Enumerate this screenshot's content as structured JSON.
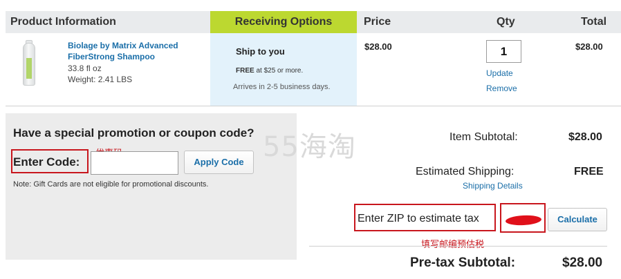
{
  "columns": {
    "product": "Product Information",
    "receiving": "Receiving Options",
    "price": "Price",
    "qty": "Qty",
    "total": "Total"
  },
  "product": {
    "name": "Biolage by Matrix Advanced FiberStrong Shampoo",
    "size": "33.8 fl oz",
    "weight": "Weight: 2.41 LBS",
    "price": "$28.00",
    "qty": "1",
    "total": "$28.00",
    "update_label": "Update",
    "remove_label": "Remove"
  },
  "shipping_option": {
    "title": "Ship to you",
    "free_bold": "FREE",
    "free_rest": " at $25 or more.",
    "days": "Arrives in 2-5 business days."
  },
  "promo": {
    "title": "Have a special promotion or coupon code?",
    "code_label": "Enter Code:",
    "code_value": "",
    "apply_label": "Apply Code",
    "note": "Note: Gift Cards are not eligible for promotional discounts."
  },
  "annotations": {
    "coupon": "优惠码",
    "zip": "填写邮编预估税"
  },
  "watermark": "55海淘",
  "summary": {
    "item_subtotal_label": "Item Subtotal:",
    "item_subtotal_value": "$28.00",
    "shipping_label": "Estimated Shipping:",
    "shipping_value": "FREE",
    "shipping_details_label": "Shipping Details",
    "zip_label": "Enter ZIP to estimate tax",
    "calculate_label": "Calculate",
    "pretax_label": "Pre-tax Subtotal:",
    "pretax_value": "$28.00"
  },
  "colors": {
    "receiving_header": "#bcd830",
    "receiving_column": "#e3f2fb",
    "link": "#1a6ea8",
    "annotation_red": "#c8161d"
  }
}
